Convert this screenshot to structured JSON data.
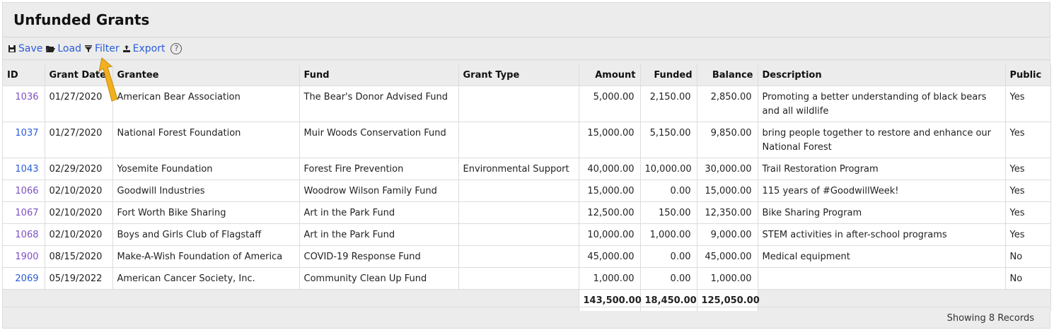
{
  "title": "Unfunded Grants",
  "toolbar": {
    "save": "Save",
    "load": "Load",
    "filter": "Filter",
    "export": "Export",
    "help": "?"
  },
  "columns": [
    "ID",
    "Grant Date",
    "Grantee",
    "Fund",
    "Grant Type",
    "Amount",
    "Funded",
    "Balance",
    "Description",
    "Public"
  ],
  "rows": [
    {
      "id": "1036",
      "date": "01/27/2020",
      "grantee": "American Bear Association",
      "fund": "The Bear's Donor Advised Fund",
      "type": "",
      "amount": "5,000.00",
      "funded": "2,150.00",
      "balance": "2,850.00",
      "description": "Promoting a better understanding of black bears and all wildlife",
      "public": "Yes"
    },
    {
      "id": "1037",
      "date": "01/27/2020",
      "grantee": "National Forest Foundation",
      "fund": "Muir Woods Conservation Fund",
      "type": "",
      "amount": "15,000.00",
      "funded": "5,150.00",
      "balance": "9,850.00",
      "description": "bring people together to restore and enhance our National Forest",
      "public": "Yes"
    },
    {
      "id": "1043",
      "date": "02/29/2020",
      "grantee": "Yosemite Foundation",
      "fund": "Forest Fire Prevention",
      "type": "Environmental Support",
      "amount": "40,000.00",
      "funded": "10,000.00",
      "balance": "30,000.00",
      "description": "Trail Restoration Program",
      "public": "Yes"
    },
    {
      "id": "1066",
      "date": "02/10/2020",
      "grantee": "Goodwill Industries",
      "fund": "Woodrow Wilson Family Fund",
      "type": "",
      "amount": "15,000.00",
      "funded": "0.00",
      "balance": "15,000.00",
      "description": "115 years of #GoodwillWeek!",
      "public": "Yes"
    },
    {
      "id": "1067",
      "date": "02/10/2020",
      "grantee": "Fort Worth Bike Sharing",
      "fund": "Art in the Park Fund",
      "type": "",
      "amount": "12,500.00",
      "funded": "150.00",
      "balance": "12,350.00",
      "description": "Bike Sharing Program",
      "public": "Yes"
    },
    {
      "id": "1068",
      "date": "02/10/2020",
      "grantee": "Boys and Girls Club of Flagstaff",
      "fund": "Art in the Park Fund",
      "type": "",
      "amount": "10,000.00",
      "funded": "1,000.00",
      "balance": "9,000.00",
      "description": "STEM activities in after-school programs",
      "public": "Yes"
    },
    {
      "id": "1900",
      "date": "08/15/2020",
      "grantee": "Make-A-Wish Foundation of America",
      "fund": "COVID-19 Response Fund",
      "type": "",
      "amount": "45,000.00",
      "funded": "0.00",
      "balance": "45,000.00",
      "description": "Medical equipment",
      "public": "No"
    },
    {
      "id": "2069",
      "date": "05/19/2022",
      "grantee": "American Cancer Society, Inc.",
      "fund": "Community Clean Up Fund",
      "type": "",
      "amount": "1,000.00",
      "funded": "0.00",
      "balance": "1,000.00",
      "description": "",
      "public": "No"
    }
  ],
  "totals": {
    "amount": "143,500.00",
    "funded": "18,450.00",
    "balance": "125,050.00"
  },
  "footer": "Showing 8 Records",
  "colors": {
    "link": "#2a5bd7",
    "visited": "#7a4fc4",
    "arrow": "#f2b01e"
  }
}
